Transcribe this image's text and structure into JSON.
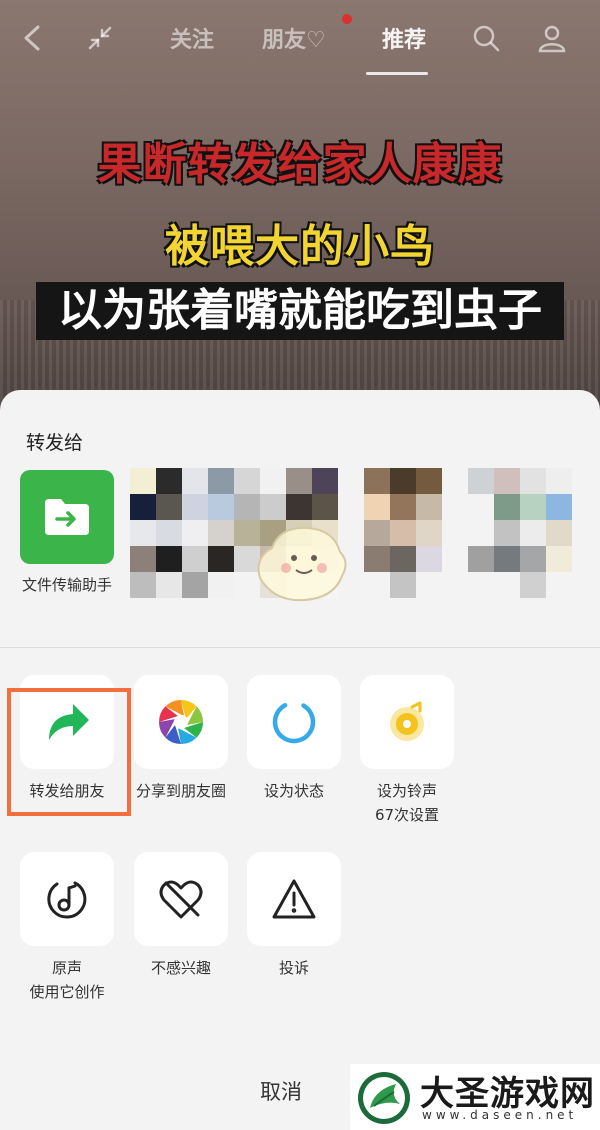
{
  "nav": {
    "tabs": [
      "关注",
      "朋友♡",
      "推荐"
    ],
    "active_tab": "推荐",
    "icons": [
      "back-icon",
      "collapse-icon",
      "search-icon",
      "profile-icon"
    ]
  },
  "video": {
    "captions": [
      "果断转发给家人康康",
      "被喂大的小鸟",
      "以为张着嘴就能吃到虫子"
    ]
  },
  "share": {
    "title": "转发给",
    "contacts": [
      {
        "label": "文件传输助手",
        "icon": "folder-forward-icon",
        "color": "#3bb54a"
      }
    ],
    "actions_row1": [
      {
        "label": "转发给朋友",
        "icon": "forward-arrow-icon",
        "color": "#21b759"
      },
      {
        "label": "分享到朋友圈",
        "icon": "moments-icon"
      },
      {
        "label": "设为状态",
        "icon": "status-ring-icon",
        "color": "#36a9e8"
      },
      {
        "label": "设为铃声\n67次设置",
        "icon": "ringtone-icon",
        "color": "#f3c21c"
      }
    ],
    "actions_row2": [
      {
        "label": "原声\n使用它创作",
        "icon": "music-note-icon"
      },
      {
        "label": "不感兴趣",
        "icon": "broken-heart-icon"
      },
      {
        "label": "投诉",
        "icon": "warning-icon"
      }
    ],
    "cancel_label": "取消",
    "highlight_color": "#f26f3d"
  },
  "watermark": {
    "title": "大圣游戏网",
    "url": "www.daseen.net"
  }
}
